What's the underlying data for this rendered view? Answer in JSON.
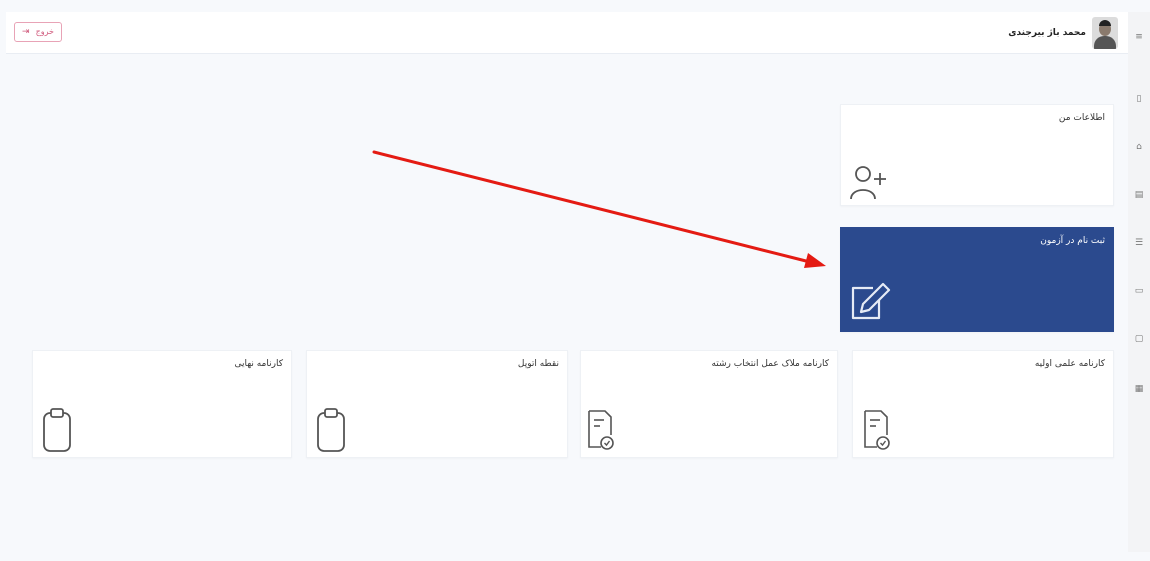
{
  "header": {
    "user_name": "محمد باژ بیرجندی",
    "exit_label": "خروج",
    "exit_icon": "logout-icon"
  },
  "rail": {
    "icons": [
      "menu-icon",
      "grid-icon",
      "home-icon",
      "doc-icon",
      "list-icon",
      "file-icon",
      "trash-icon",
      "calendar-icon"
    ]
  },
  "cards": {
    "personal_info": {
      "title": "اطلاعات من",
      "icon": "user-add-icon"
    },
    "exam_register": {
      "title": "ثبت نام در آزمون",
      "icon": "edit-icon",
      "accent": "#2b4a8e"
    },
    "initial_report": {
      "title": "کارنامه علمی اولیه",
      "icon": "report-icon"
    },
    "choice_report": {
      "title": "کارنامه ملاک عمل انتخاب رشته",
      "icon": "report-icon"
    },
    "seat_card": {
      "title": "نقطه اتوپل",
      "icon": "clipboard-icon"
    },
    "final_report": {
      "title": "کارنامه نهایی",
      "icon": "clipboard-icon"
    }
  },
  "annotation": {
    "arrow_color": "#e41b13"
  }
}
